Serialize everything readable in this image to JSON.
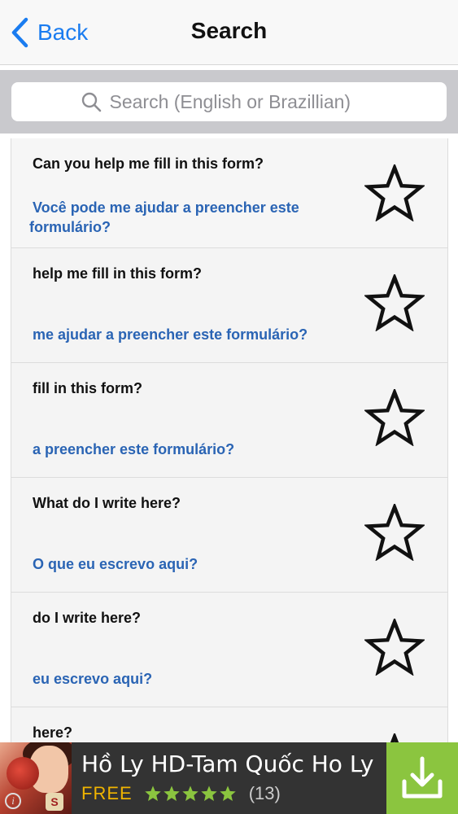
{
  "navbar": {
    "back_label": "Back",
    "title": "Search"
  },
  "search": {
    "placeholder": "Search (English or Brazillian)"
  },
  "phrases": [
    {
      "english": "Can you help me fill in this form?",
      "portuguese": "Você pode me ajudar a preencher este formulário?"
    },
    {
      "english": "help me fill in this form?",
      "portuguese": "me ajudar a preencher este formulário?"
    },
    {
      "english": "fill in this form?",
      "portuguese": "a preencher este formulário?"
    },
    {
      "english": "What do I write here?",
      "portuguese": "O que eu escrevo aqui?"
    },
    {
      "english": "do I write here?",
      "portuguese": "eu escrevo aqui?"
    },
    {
      "english": "here?",
      "portuguese": ""
    }
  ],
  "ad": {
    "title": "Hồ Ly HD-Tam Quốc Ho Ly",
    "price_label": "FREE",
    "rating": 5,
    "review_count": "(13)",
    "badge_letter": "S",
    "info_glyph": "i"
  },
  "colors": {
    "accent": "#1a7cf0",
    "translation": "#2a64b4",
    "ad_star": "#8bc53f",
    "ad_free": "#f0b400",
    "download_bg": "#8bc53f"
  },
  "icons": {
    "back": "chevron-left-icon",
    "search": "magnifier-icon",
    "favorite": "star-outline-icon",
    "download": "download-icon"
  }
}
